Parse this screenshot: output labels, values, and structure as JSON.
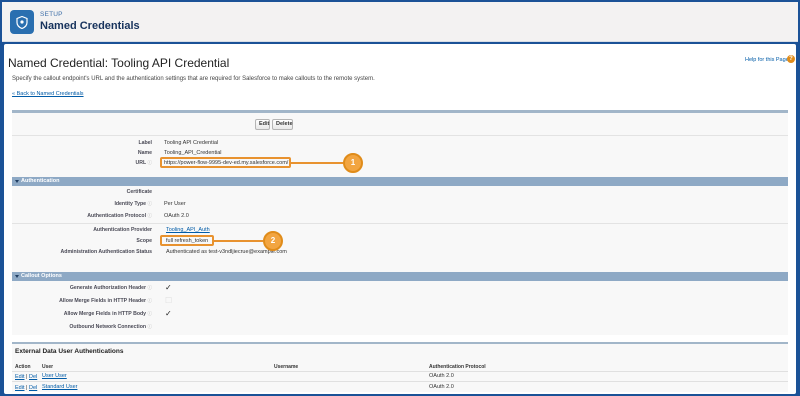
{
  "header": {
    "section": "SETUP",
    "title": "Named Credentials"
  },
  "page": {
    "title": "Named Credential: Tooling API Credential",
    "description": "Specify the callout endpoint's URL and the authentication settings that are required for Salesforce to make callouts to the remote system.",
    "back_link": "« Back to Named Credentials",
    "help_link": "Help for this Page",
    "help_icon": "?"
  },
  "buttons": {
    "edit": "Edit",
    "delete": "Delete"
  },
  "fields": {
    "label": {
      "label": "Label",
      "value": "Tooling API Credential"
    },
    "name": {
      "label": "Name",
      "value": "Tooling_API_Credential"
    },
    "url": {
      "label": "URL",
      "value": "https://power-flow-9995-dev-ed.my.salesforce.com/"
    }
  },
  "authentication": {
    "section_title": "Authentication",
    "certificate": {
      "label": "Certificate",
      "value": ""
    },
    "identity_type": {
      "label": "Identity Type",
      "value": "Per User"
    },
    "auth_protocol": {
      "label": "Authentication Protocol",
      "value": "OAuth 2.0"
    },
    "auth_provider": {
      "label": "Authentication Provider",
      "value": "Tooling_API_Auth"
    },
    "scope": {
      "label": "Scope",
      "value": "full refresh_token"
    },
    "admin_status": {
      "label": "Administration Authentication Status",
      "value": "Authenticated as test-v3ndljiecrue@example.com"
    }
  },
  "callout": {
    "section_title": "Callout Options",
    "gen_auth_header": {
      "label": "Generate Authorization Header",
      "checked": true
    },
    "merge_header": {
      "label": "Allow Merge Fields in HTTP Header",
      "checked": false
    },
    "merge_body": {
      "label": "Allow Merge Fields in HTTP Body",
      "checked": true
    },
    "outbound_conn": {
      "label": "Outbound Network Connection",
      "value": ""
    }
  },
  "callouts": {
    "one": "1",
    "two": "2"
  },
  "related": {
    "title": "External Data User Authentications",
    "columns": [
      "Action",
      "User",
      "Username",
      "Authentication Protocol"
    ],
    "rows": [
      {
        "edit": "Edit",
        "sep": "|",
        "del": "Del",
        "user": "User User",
        "username": "",
        "protocol": "OAuth 2.0"
      },
      {
        "edit": "Edit",
        "sep": "|",
        "del": "Del",
        "user": "Standard User",
        "username": "",
        "protocol": "OAuth 2.0"
      }
    ]
  },
  "colors": {
    "frame": "#1b5297",
    "section_bar": "#8ea9c5",
    "callout": "#e8922f",
    "link": "#015ba7"
  }
}
